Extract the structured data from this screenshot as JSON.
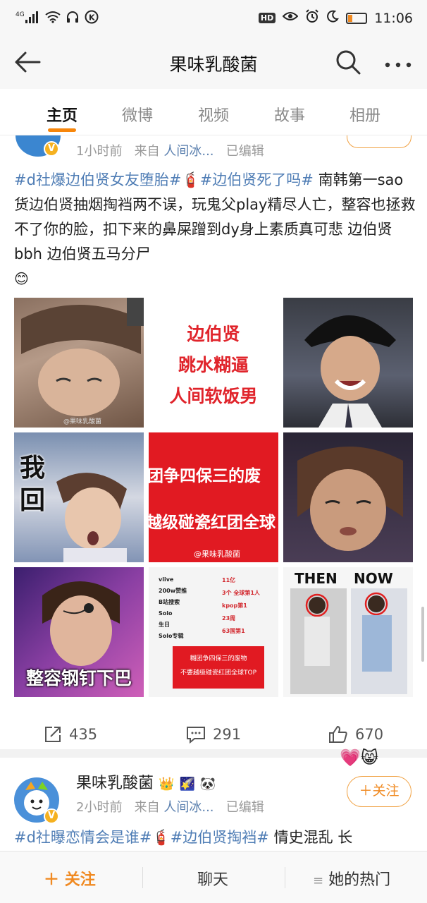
{
  "status_bar": {
    "network": "4G",
    "hd": "HD",
    "time": "11:06"
  },
  "header": {
    "title": "果味乳酸菌"
  },
  "tabs": [
    {
      "label": "主页",
      "active": true
    },
    {
      "label": "微博",
      "active": false
    },
    {
      "label": "视频",
      "active": false
    },
    {
      "label": "故事",
      "active": false
    },
    {
      "label": "相册",
      "active": false
    }
  ],
  "post1": {
    "time": "1小时前",
    "source_prefix": "来自",
    "source": "人间冰...",
    "edited": "已编辑",
    "text": {
      "tag1": "#d社爆边伯贤女友堕胎#",
      "tag2": "#边伯贤死了吗#",
      "body": "南韩第一sao货边伯贤抽烟掏裆两不误，玩鬼父play精尽人亡，整容也拯救不了你的脸，扣下来的鼻屎蹭到dy身上素质真可悲 边伯贤 bbh  边伯贤五马分尸"
    },
    "images": {
      "img2_lines": [
        "边伯贤",
        "跳水糊逼",
        "人间软饭男"
      ],
      "img4_chars": [
        "我",
        "回"
      ],
      "img5_lines": [
        "团争四保三的废",
        "越级碰瓷红团全球"
      ],
      "img5_watermark": "@果味乳酸菌",
      "img7_caption": "整容钢钉下巴",
      "img8_red_lines": [
        "糊团争四保三的废物",
        "不要越级碰瓷红团全球TOP"
      ],
      "img8_rows": [
        "vlive",
        "200w赞推",
        "B站搜索",
        "Solo",
        "生日",
        "Solo专辑"
      ],
      "img8_values": [
        "11亿",
        "3个 全球第1人",
        "kpop第1",
        "23周",
        "63国第1"
      ],
      "img9_then": "THEN",
      "img9_now": "NOW"
    },
    "actions": {
      "repost": "435",
      "comment": "291",
      "like": "670"
    }
  },
  "post2": {
    "name": "果味乳酸菌",
    "time": "2小时前",
    "source_prefix": "来自",
    "source": "人间冰...",
    "edited": "已编辑",
    "follow_label": "关注",
    "text": {
      "tag1": "#d社曝恋情会是谁#",
      "tag2": "#边伯贤掏裆#",
      "body": "情史混乱 长"
    }
  },
  "bottom_bar": {
    "follow": "关注",
    "chat": "聊天",
    "hot": "她的热门"
  },
  "colors": {
    "accent": "#f7860b",
    "link": "#4f7db5"
  }
}
